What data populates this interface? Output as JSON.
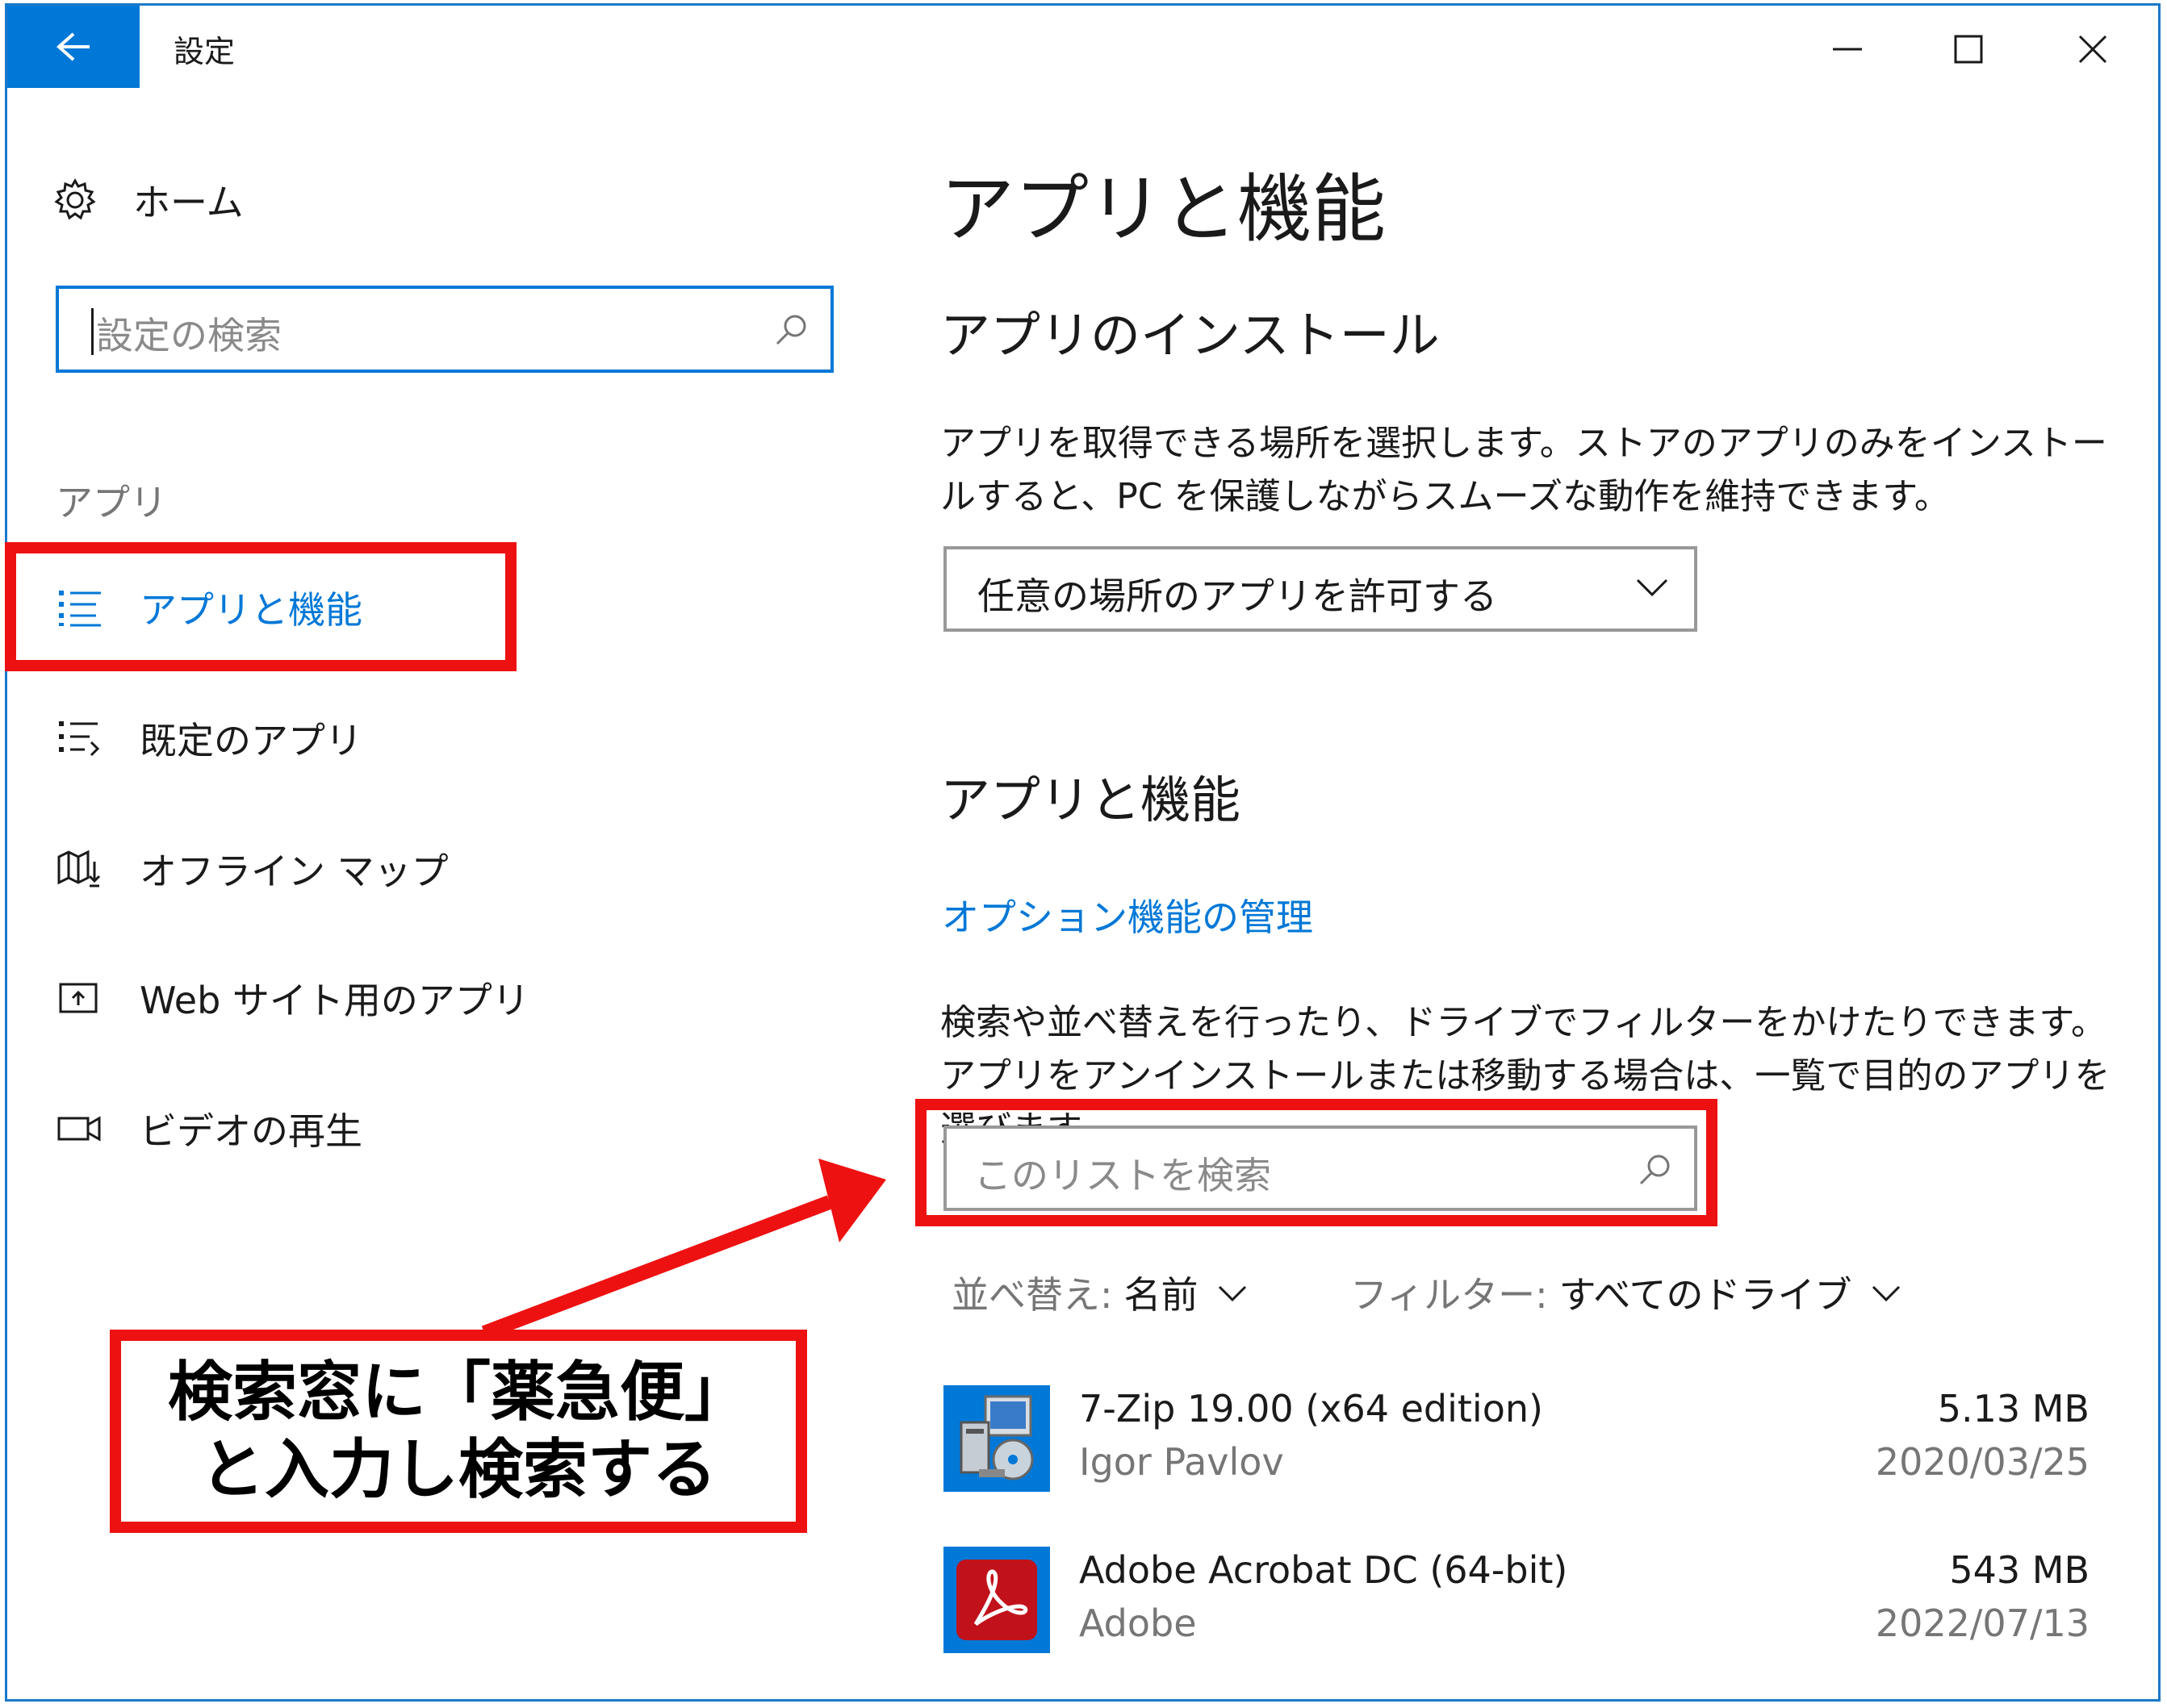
{
  "window": {
    "title": "設定",
    "controls": {
      "minimize_icon": "minimize-icon",
      "maximize_icon": "maximize-icon",
      "close_icon": "close-icon"
    }
  },
  "sidebar": {
    "home_label": "ホーム",
    "search_placeholder": "設定の検索",
    "section_label": "アプリ",
    "items": [
      {
        "label": "アプリと機能",
        "icon": "apps-features-icon",
        "active": true
      },
      {
        "label": "既定のアプリ",
        "icon": "default-apps-icon",
        "active": false
      },
      {
        "label": "オフライン マップ",
        "icon": "offline-maps-icon",
        "active": false
      },
      {
        "label": "Web サイト用のアプリ",
        "icon": "apps-for-websites-icon",
        "active": false
      },
      {
        "label": "ビデオの再生",
        "icon": "video-playback-icon",
        "active": false
      }
    ]
  },
  "main": {
    "page_title": "アプリと機能",
    "install_heading": "アプリのインストール",
    "install_desc": "アプリを取得できる場所を選択します。ストアのアプリのみをインストールすると、PC を保護しながらスムーズな動作を維持できます。",
    "install_dropdown_value": "任意の場所のアプリを許可する",
    "features_heading": "アプリと機能",
    "optional_features_link": "オプション機能の管理",
    "list_desc": "検索や並べ替えを行ったり、ドライブでフィルターをかけたりできます。アプリをアンインストールまたは移動する場合は、一覧で目的のアプリを選びます。",
    "list_search_placeholder": "このリストを検索",
    "sort_label": "並べ替え:",
    "sort_value": "名前",
    "filter_label": "フィルター:",
    "filter_value": "すべてのドライブ",
    "apps": [
      {
        "name": "7-Zip 19.00 (x64 edition)",
        "publisher": "Igor Pavlov",
        "size": "5.13 MB",
        "date": "2020/03/25"
      },
      {
        "name": "Adobe Acrobat DC (64-bit)",
        "publisher": "Adobe",
        "size": "543 MB",
        "date": "2022/07/13"
      }
    ]
  },
  "annotation": {
    "line1": "検索窓に「薬急便」",
    "line2": "と入力し検索する",
    "color": "#ee1111"
  },
  "colors": {
    "accent": "#0078d7",
    "highlight": "#ee1111"
  }
}
